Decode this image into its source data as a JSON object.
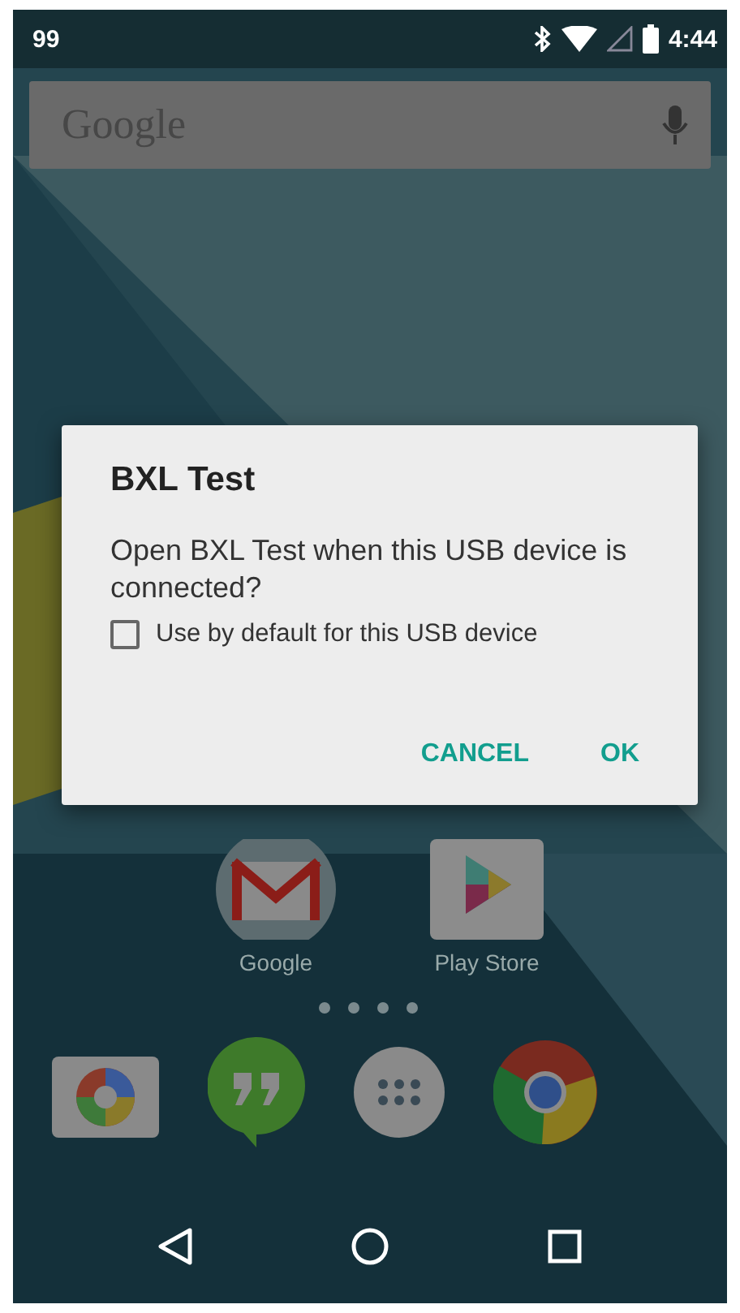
{
  "status_bar": {
    "notification": "99",
    "time": "4:44"
  },
  "search": {
    "placeholder": "Google"
  },
  "home_icons": [
    {
      "kind": "gmail",
      "label": "Google"
    },
    {
      "kind": "play",
      "label": "Play Store"
    }
  ],
  "dock": [
    {
      "kind": "camera"
    },
    {
      "kind": "hangouts"
    },
    {
      "kind": "apps"
    },
    {
      "kind": "chrome"
    }
  ],
  "nav": [
    {
      "kind": "back"
    },
    {
      "kind": "home"
    },
    {
      "kind": "recent"
    }
  ],
  "dialog": {
    "title": "BXL Test",
    "message": "Open BXL Test when this USB device is connected?",
    "checkbox": {
      "label": "Use by default for this USB device",
      "checked": false
    },
    "buttons": [
      "CANCEL",
      "OK"
    ]
  }
}
